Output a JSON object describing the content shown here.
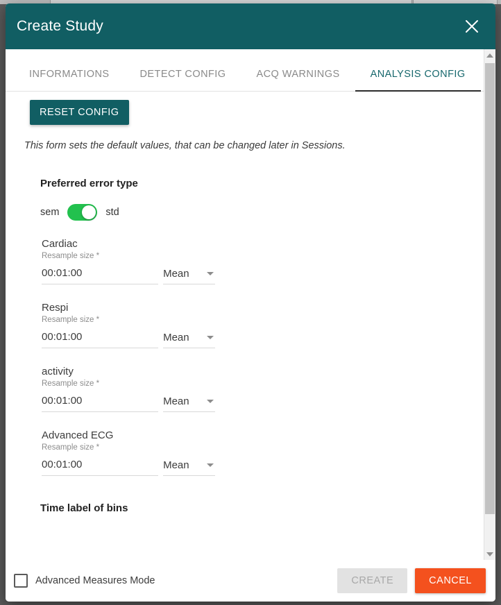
{
  "dialog": {
    "title": "Create Study",
    "close_icon": "close-icon"
  },
  "tabs": [
    {
      "label": "INFORMATIONS",
      "active": false
    },
    {
      "label": "DETECT CONFIG",
      "active": false
    },
    {
      "label": "ACQ WARNINGS",
      "active": false
    },
    {
      "label": "ANALYSIS CONFIG",
      "active": true
    }
  ],
  "toolbar": {
    "reset_config_label": "RESET CONFIG"
  },
  "form": {
    "hint": "This form sets the default values, that can be changed later in Sessions.",
    "section_title": "Preferred error type",
    "toggle": {
      "left_label": "sem",
      "right_label": "std",
      "state": "std",
      "color": "#22c14e"
    },
    "resample_sub_label": "Resample size *",
    "metrics": [
      {
        "name": "Cardiac",
        "sub": "Resample size *",
        "value": "00:01:00",
        "aggregation": "Mean"
      },
      {
        "name": "Respi",
        "sub": "Resample size *",
        "value": "00:01:00",
        "aggregation": "Mean"
      },
      {
        "name": "activity",
        "sub": "Resample size *",
        "value": "00:01:00",
        "aggregation": "Mean"
      },
      {
        "name": "Advanced ECG",
        "sub": "Resample size *",
        "value": "00:01:00",
        "aggregation": "Mean"
      }
    ],
    "bins_title": "Time label of bins"
  },
  "footer": {
    "advanced_measures_label": "Advanced Measures Mode",
    "advanced_measures_checked": false,
    "create_label": "CREATE",
    "create_disabled": true,
    "cancel_label": "CANCEL"
  },
  "colors": {
    "header": "#115e63",
    "accent": "#16676c",
    "toggle_on": "#22c14e",
    "cancel": "#f4511e",
    "create_disabled_bg": "#e2e2e2"
  }
}
